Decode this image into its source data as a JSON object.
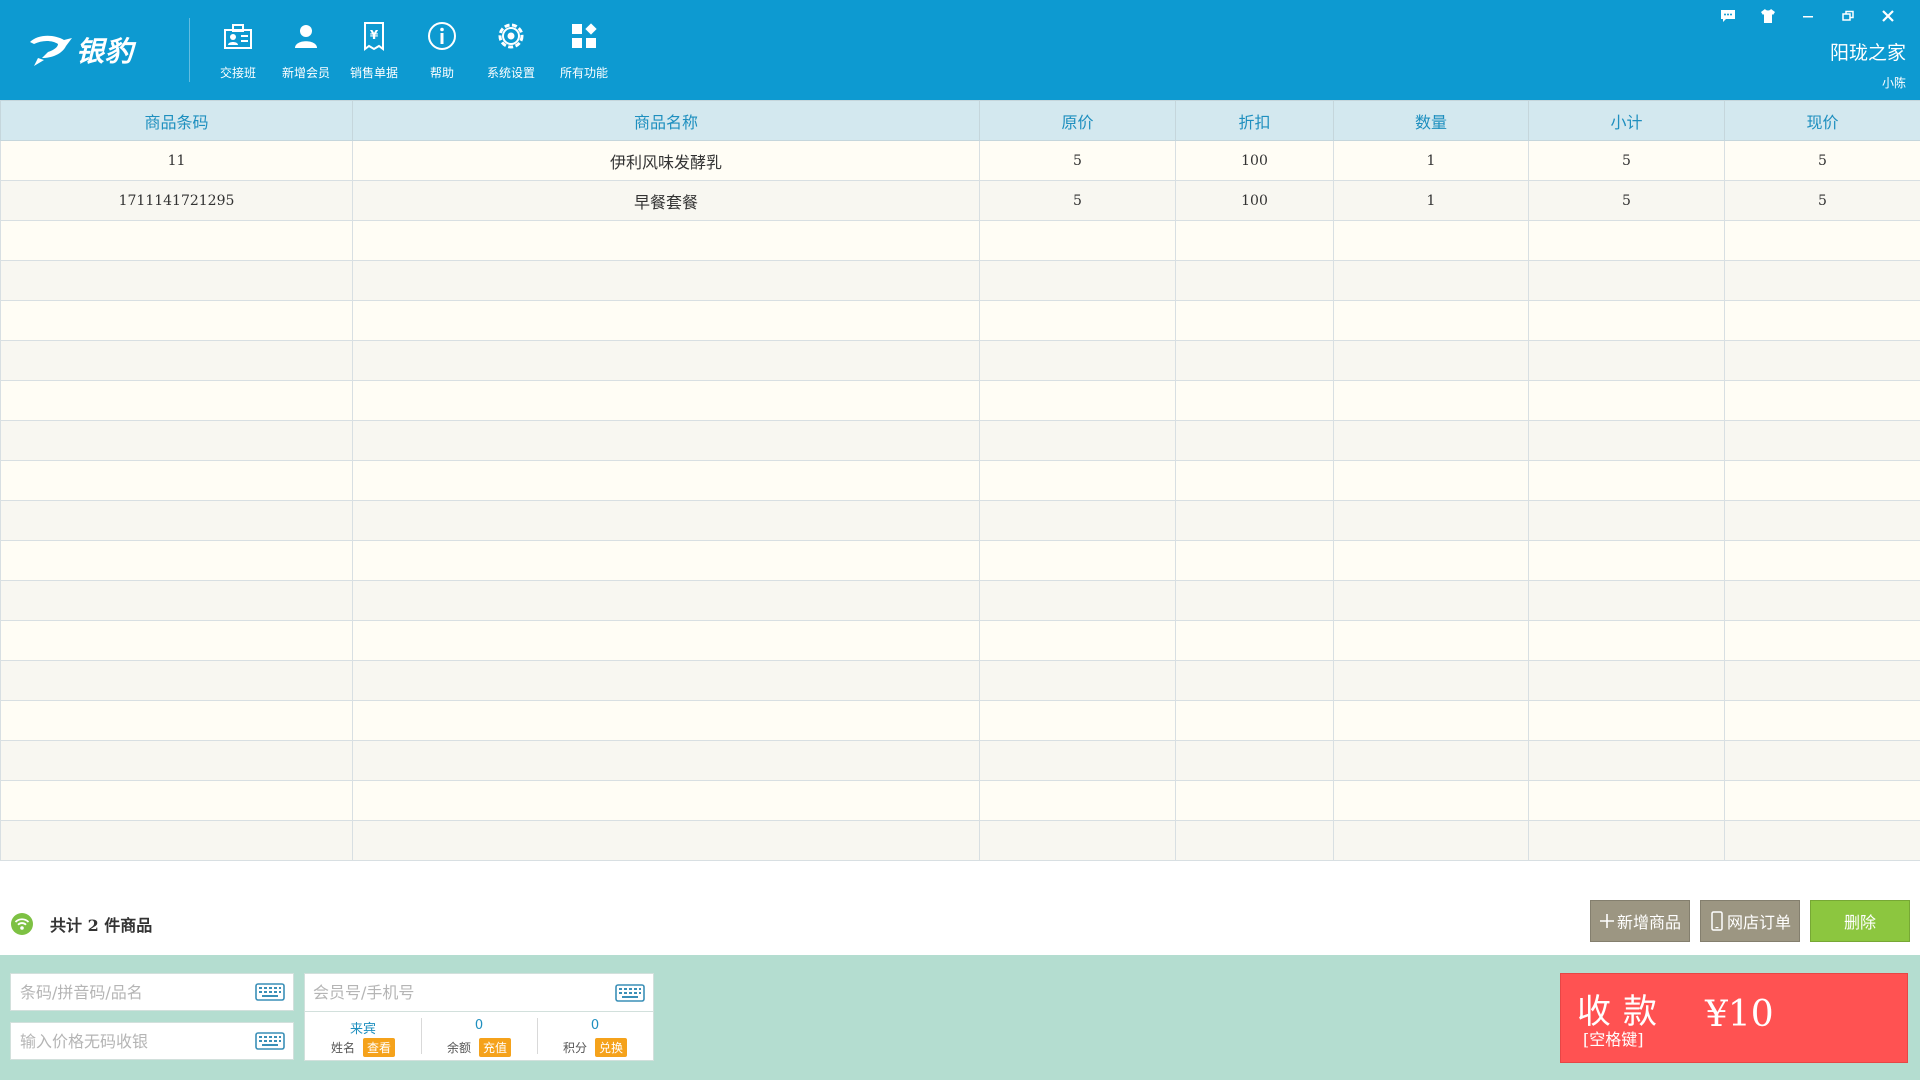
{
  "header": {
    "logo_text": "银豹",
    "nav": [
      {
        "label": "交接班",
        "icon": "shift-handover-icon"
      },
      {
        "label": "新增会员",
        "icon": "add-member-icon"
      },
      {
        "label": "销售单据",
        "icon": "sales-receipt-icon"
      },
      {
        "label": "帮助",
        "icon": "help-icon"
      },
      {
        "label": "系统设置",
        "icon": "settings-icon"
      },
      {
        "label": "所有功能",
        "icon": "all-functions-icon"
      }
    ],
    "store_name": "阳珑之家",
    "user_name": "小陈"
  },
  "table": {
    "columns": [
      "商品条码",
      "商品名称",
      "原价",
      "折扣",
      "数量",
      "小计",
      "现价"
    ],
    "rows": [
      {
        "barcode": "11",
        "name": "伊利风味发酵乳",
        "original_price": "5",
        "discount": "100",
        "quantity": "1",
        "subtotal": "5",
        "current_price": "5"
      },
      {
        "barcode": "1711141721295",
        "name": "早餐套餐",
        "original_price": "5",
        "discount": "100",
        "quantity": "1",
        "subtotal": "5",
        "current_price": "5"
      }
    ]
  },
  "summary": {
    "text": "共计 2 件商品"
  },
  "actions": {
    "add_product": "新增商品",
    "online_order": "网店订单",
    "delete": "删除"
  },
  "inputs": {
    "search_placeholder": "条码/拼音码/品名",
    "price_placeholder": "输入价格无码收银",
    "member_placeholder": "会员号/手机号"
  },
  "member": {
    "name_value": "来宾",
    "name_label": "姓名",
    "view_btn": "查看",
    "balance_value": "0",
    "balance_label": "余额",
    "recharge_btn": "充值",
    "points_value": "0",
    "points_label": "积分",
    "redeem_btn": "兑换"
  },
  "pay": {
    "title": "收款",
    "hint": "[空格键]",
    "amount": "¥10"
  },
  "colors": {
    "header_bg": "#0d9ad1",
    "bottom_bg": "#b4ddd0",
    "pay_bg": "#ff5252",
    "delete_bg": "#8cc63f",
    "secondary_btn_bg": "#9c9682",
    "badge_bg": "#f5a21b"
  }
}
